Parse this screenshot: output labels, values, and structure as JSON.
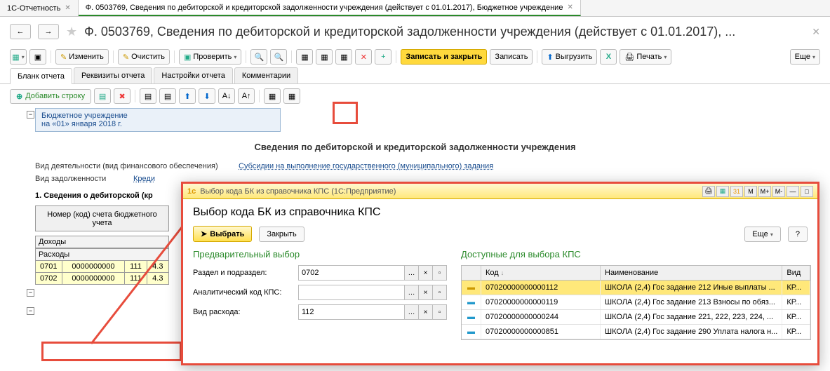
{
  "tabs": {
    "t1": "1С-Отчетность",
    "t2": "Ф. 0503769, Сведения по дебиторской и кредиторской задолженности учреждения (действует с 01.01.2017), Бюджетное учреждение"
  },
  "page_title": "Ф. 0503769, Сведения по дебиторской и кредиторской задолженности учреждения (действует с 01.01.2017), ...",
  "toolbar": {
    "edit": "Изменить",
    "clear": "Очистить",
    "check": "Проверить",
    "save_close": "Записать и закрыть",
    "save": "Записать",
    "export": "Выгрузить",
    "print": "Печать",
    "more": "Еще"
  },
  "sub_tabs": {
    "t1": "Бланк отчета",
    "t2": "Реквизиты отчета",
    "t3": "Настройки отчета",
    "t4": "Комментарии"
  },
  "add_row": "Добавить строку",
  "org": {
    "l1": "Бюджетное учреждение",
    "l2": "на «01» января 2018 г."
  },
  "doc_title": "Сведения по дебиторской и кредиторской задолженности учреждения",
  "fields": {
    "activity_lbl": "Вид деятельности (вид финансового обеспечения)",
    "activity_val": "Субсидии на выполнение государственного (муниципального) задания",
    "debt_lbl": "Вид задолженности",
    "debt_val": "Креди"
  },
  "section1": "1. Сведения о дебиторской (кр",
  "account_hdr": "Номер (код) счета бюджетного учета",
  "rows": {
    "income": "Доходы",
    "expense": "Расходы",
    "r1": {
      "c1": "0701",
      "c2": "0000000000",
      "c3": "111",
      "c4": "4.3"
    },
    "r2": {
      "c1": "0702",
      "c2": "0000000000",
      "c3": "111",
      "c4": "4.3"
    }
  },
  "modal": {
    "winbar": "Выбор кода БК из справочника КПС (1С:Предприятие)",
    "title": "Выбор кода БК из справочника КПС",
    "select": "Выбрать",
    "close": "Закрыть",
    "more": "Еще",
    "help": "?",
    "left_h": "Предварительный выбор",
    "right_h": "Доступные для выбора КПС",
    "f1_lbl": "Раздел и подраздел:",
    "f1_val": "0702",
    "f2_lbl": "Аналитический код КПС:",
    "f2_val": "",
    "f3_lbl": "Вид расхода:",
    "f3_val": "112",
    "grid": {
      "h1": "Код",
      "h2": "Наименование",
      "h3": "Вид",
      "rows": [
        {
          "code": "07020000000000112",
          "name": "ШКОЛА (2,4) Гос задание 212 Иные выплаты ...",
          "kind": "КР..."
        },
        {
          "code": "07020000000000119",
          "name": "ШКОЛА (2,4) Гос задание 213 Взносы по обяз...",
          "kind": "КР..."
        },
        {
          "code": "07020000000000244",
          "name": "ШКОЛА (2,4) Гос задание 221, 222, 223, 224, ...",
          "kind": "КР..."
        },
        {
          "code": "07020000000000851",
          "name": "ШКОЛА (2,4) Гос задание 290 Уплата налога н...",
          "kind": "КР..."
        }
      ]
    }
  }
}
